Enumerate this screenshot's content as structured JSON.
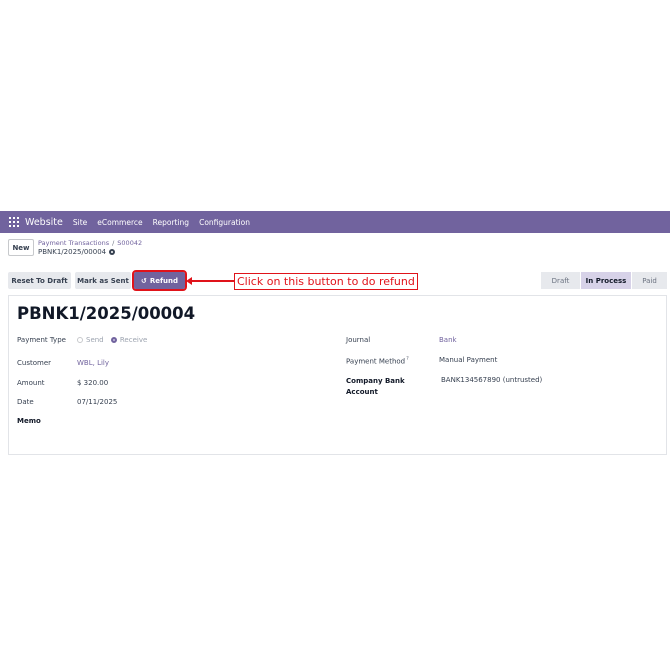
{
  "navbar": {
    "brand": "Website",
    "items": [
      "Site",
      "eCommerce",
      "Reporting",
      "Configuration"
    ]
  },
  "control_panel": {
    "new_label": "New",
    "breadcrumb": [
      "Payment Transactions",
      "S00042"
    ],
    "breadcrumb_sep": "/",
    "record_name": "PBNK1/2025/00004"
  },
  "actions": {
    "reset_to_draft": "Reset To Draft",
    "mark_as_sent": "Mark as Sent",
    "refund": "Refund"
  },
  "annotation": {
    "text": "Click on this button to do refund"
  },
  "statusbar": {
    "stages": [
      "Draft",
      "In Process",
      "Paid"
    ],
    "active": "In Process"
  },
  "form": {
    "title": "PBNK1/2025/00004",
    "payment_type_label": "Payment Type",
    "payment_type_options": [
      "Send",
      "Receive"
    ],
    "payment_type_selected": "Receive",
    "customer_label": "Customer",
    "customer_value": "WBL, Lily",
    "amount_label": "Amount",
    "amount_value": "$ 320.00",
    "date_label": "Date",
    "date_value": "07/11/2025",
    "memo_label": "Memo",
    "journal_label": "Journal",
    "journal_value": "Bank",
    "payment_method_label": "Payment Method",
    "payment_method_help": "?",
    "payment_method_value": "Manual Payment",
    "company_bank_label_line1": "Company Bank",
    "company_bank_label_line2": "Account",
    "company_bank_value": "BANK134567890 (untrusted)"
  },
  "colors": {
    "brand": "#71639e",
    "annotation": "#e0131a"
  }
}
